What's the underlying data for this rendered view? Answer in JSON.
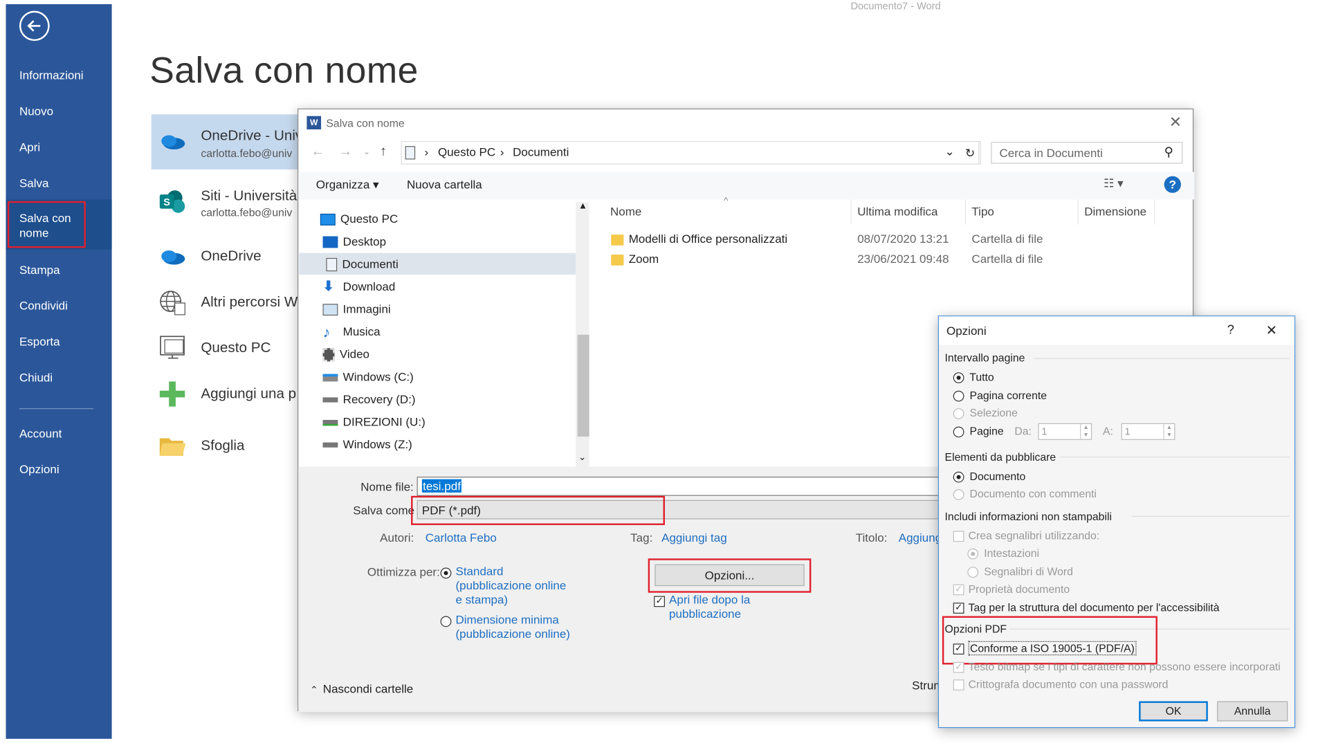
{
  "backstage": {
    "nav": [
      "Informazioni",
      "Nuovo",
      "Apri",
      "Salva",
      "Salva con nome",
      "Stampa",
      "Condividi",
      "Esporta",
      "Chiudi",
      "Account",
      "Opzioni"
    ],
    "accent": "#2b579a",
    "title": "Salva con nome",
    "doc_caption": "Documento7 - Word",
    "locations": [
      {
        "name": "OneDrive - Univ",
        "sub": "carlotta.febo@univ",
        "icon": "onedrive-icon"
      },
      {
        "name": "Siti - Università",
        "sub": "carlotta.febo@univ",
        "icon": "sharepoint-icon"
      },
      {
        "name": "OneDrive",
        "sub": "",
        "icon": "onedrive-icon"
      },
      {
        "name": "Altri percorsi W",
        "sub": "",
        "icon": "globe-icon"
      },
      {
        "name": "Questo PC",
        "sub": "",
        "icon": "pc-icon"
      },
      {
        "name": "Aggiungi una p",
        "sub": "",
        "icon": "plus-icon"
      },
      {
        "name": "Sfoglia",
        "sub": "",
        "icon": "folder-open-icon"
      }
    ]
  },
  "save_dialog": {
    "title": "Salva con nome",
    "address": {
      "root": "Questo PC",
      "folder": "Documenti"
    },
    "search_placeholder": "Cerca in Documenti",
    "organize": "Organizza ▾",
    "new_folder": "Nuova cartella",
    "nav_items": [
      "Questo PC",
      "Desktop",
      "Documenti",
      "Download",
      "Immagini",
      "Musica",
      "Video",
      "Windows (C:)",
      "Recovery (D:)",
      "DIREZIONI (U:)",
      "Windows (Z:)"
    ],
    "columns": [
      "Nome",
      "Ultima modifica",
      "Tipo",
      "Dimensione"
    ],
    "files": [
      {
        "name": "Modelli di Office personalizzati",
        "modified": "08/07/2020 13:21",
        "type": "Cartella di file"
      },
      {
        "name": "Zoom",
        "modified": "23/06/2021 09:48",
        "type": "Cartella di file"
      }
    ],
    "filename_label": "Nome file:",
    "filename": "tesi.pdf",
    "filetype_label": "Salva come",
    "filetype": "PDF (*.pdf)",
    "authors_label": "Autori:",
    "authors": "Carlotta Febo",
    "tags_label": "Tag:",
    "tags": "Aggiungi tag",
    "title_label": "Titolo:",
    "title_value": "Aggiung",
    "optimize_label": "Ottimizza per:",
    "optimize_standard": [
      "Standard",
      "(pubblicazione online",
      "e stampa)"
    ],
    "optimize_min": [
      "Dimensione minima",
      "(pubblicazione online)"
    ],
    "options_button": "Opzioni...",
    "open_after": [
      "Apri file dopo la",
      "pubblicazione"
    ],
    "hide_folders": "Nascondi cartelle",
    "tools": "Strum"
  },
  "options_dialog": {
    "title": "Opzioni",
    "help": "?",
    "close": "✕",
    "page_range": "Intervallo pagine",
    "all": "Tutto",
    "current_page": "Pagina corrente",
    "selection": "Selezione",
    "pages": "Pagine",
    "from_label": "Da:",
    "from_value": "1",
    "to_label": "A:",
    "to_value": "1",
    "publish": "Elementi da pubblicare",
    "document": "Documento",
    "document_comments": "Documento con commenti",
    "nonprint": "Includi informazioni non stampabili",
    "bookmarks": "Crea segnalibri utilizzando:",
    "headings": "Intestazioni",
    "word_bookmarks": "Segnalibri di Word",
    "doc_props": "Proprietà documento",
    "tags_access": "Tag per la struttura del documento per l'accessibilità",
    "pdf_options": "Opzioni PDF",
    "iso": "Conforme a ISO 19005-1 (PDF/A)",
    "bitmap": "Testo bitmap se i tipi di carattere non possono essere incorporati",
    "encrypt": "Crittografa documento con una password",
    "ok": "OK",
    "cancel": "Annulla"
  }
}
